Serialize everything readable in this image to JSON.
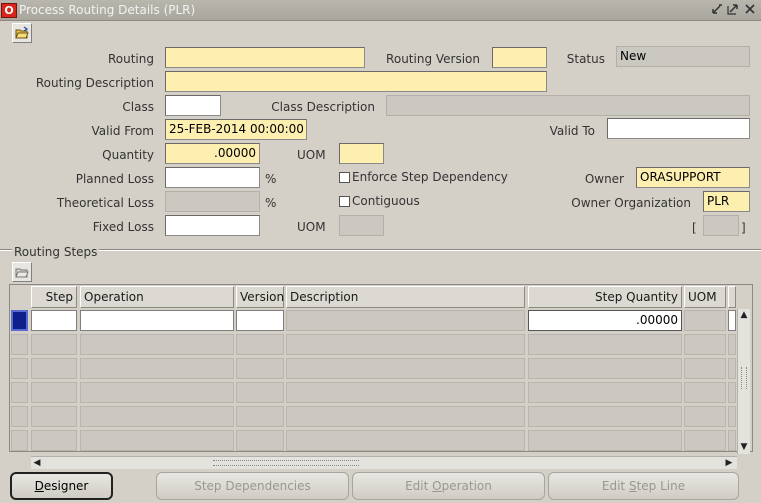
{
  "window": {
    "title": "Process Routing Details (PLR)",
    "app_icon": "O"
  },
  "header": {
    "routing_label": "Routing",
    "routing_value": "",
    "routing_version_label": "Routing Version",
    "routing_version_value": "",
    "status_label": "Status",
    "status_value": "New",
    "routing_description_label": "Routing Description",
    "routing_description_value": "",
    "class_label": "Class",
    "class_value": "",
    "class_description_label": "Class Description",
    "class_description_value": "",
    "valid_from_label": "Valid From",
    "valid_from_value": "25-FEB-2014 00:00:00",
    "valid_to_label": "Valid To",
    "valid_to_value": "",
    "quantity_label": "Quantity",
    "quantity_value": ".00000",
    "uom_label": "UOM",
    "uom_value": "",
    "planned_loss_label": "Planned Loss",
    "planned_loss_value": "",
    "percent": "%",
    "enforce_step_dependency_label": "Enforce Step Dependency",
    "owner_label": "Owner",
    "owner_value": "ORASUPPORT",
    "theoretical_loss_label": "Theoretical Loss",
    "contiguous_label": "Contiguous",
    "owner_org_label": "Owner Organization",
    "owner_org_value": "PLR",
    "fixed_loss_label": "Fixed Loss",
    "fixed_loss_uom_label": "UOM",
    "bracket_open": "[",
    "bracket_close": "]"
  },
  "routing_steps": {
    "section_title": "Routing Steps",
    "columns": [
      "Step",
      "Operation",
      "Version",
      "Description",
      "Step Quantity",
      "UOM"
    ],
    "first_row_step_quantity": ".00000",
    "row_count": 6
  },
  "buttons": {
    "designer": "Designer",
    "designer_mnemonic": "D",
    "designer_rest": "esigner",
    "step_dependencies": "Step Dependencies",
    "edit_operation_pre": "Edit ",
    "edit_operation_mn": "O",
    "edit_operation_post": "peration",
    "edit_step_line_pre": "Edit ",
    "edit_step_line_mn": "S",
    "edit_step_line_post": "tep Line"
  },
  "icons": {
    "toolbar": "folder-open-icon",
    "steps_toolbar": "folder-open-icon",
    "minimize": "minimize-icon",
    "maximize": "maximize-icon",
    "close": "close-icon"
  },
  "colors": {
    "required_field": "#fcefb0",
    "readonly_field": "#cbc8c1",
    "current_record": "#0e1f8c"
  }
}
